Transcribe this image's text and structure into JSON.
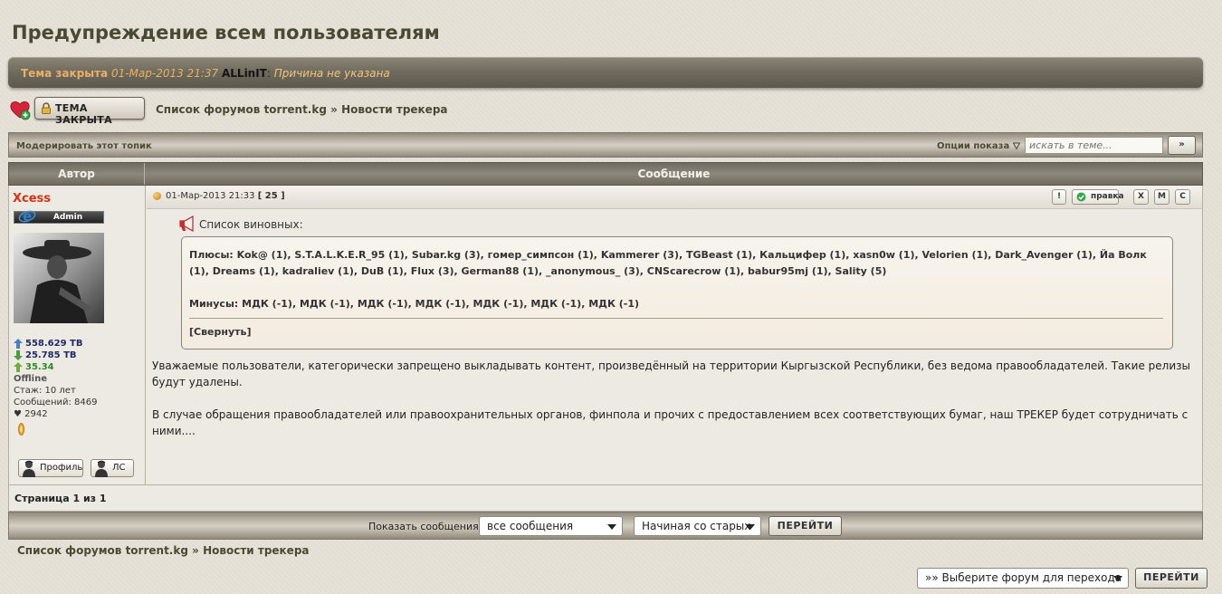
{
  "topic": {
    "title": "Предупреждение всем пользователям"
  },
  "closed_notice": {
    "label": "Тема закрыта",
    "date": "01-Мар-2013 21:37",
    "user": "ALLinIT",
    "reason": "Причина не указана"
  },
  "nav": {
    "closed_button": "Тема закрыта",
    "crumb_forums": "Список форумов torrent.kg",
    "crumb_sep": "»",
    "crumb_section": "Новости трекера"
  },
  "toolbar": {
    "moderate": "Модерировать этот топик",
    "view_options": "Опции показа",
    "search_placeholder": "искать в теме...",
    "search_button": "»"
  },
  "table": {
    "col_author": "Автор",
    "col_message": "Сообщение"
  },
  "author": {
    "name": "Xcess",
    "rank": "Admin",
    "uploaded": "558.629 TB",
    "downloaded": "25.785 TB",
    "ratio": "35.34",
    "status": "Offline",
    "tenure": "Стаж: 10 лет",
    "posts": "Сообщений: 8469",
    "rep": "♥ 2942",
    "profile_btn": "Профиль",
    "pm_btn": "ЛС",
    "colors": {
      "name": "#d9300f",
      "ratio": "#2e8a2e"
    }
  },
  "post": {
    "date": "01-Мар-2013 21:33",
    "number": "[ 25 ]",
    "buttons": [
      "!",
      "правка",
      "X",
      "M",
      "C"
    ],
    "quote_label": "Список виновных:",
    "spoiler": {
      "plus": "Плюсы: Kok@ (1), S.T.A.L.K.E.R_95 (1), Subar.kg (3), гомер_симпсон (1), Kammerer (3), TGBeast (1), Кальцифер (1), xasn0w (1), Velorien (1), Dark_Avenger (1), Йа Волк (1), Dreams (1), kadraliev (1), DuB (1), Flux (3), German88 (1), _anonymous_ (3), CNScarecrow (1), babur95mj (1), Sality (5)",
      "minus": "Минусы: МДК (-1), МДК (-1), МДК (-1), МДК (-1), МДК (-1), МДК (-1), МДК (-1)",
      "collapse": "[Свернуть]"
    },
    "paragraph1": "Уважаемые пользователи, категорически запрещено выкладывать контент, произведённый на территории Кыргызской Республики, без ведома правообладателей. Такие релизы будут удалены.",
    "paragraph2": "В случае обращения правообладателей или правоохранительных органов, финпола и прочих с предоставлением всех соответствующих бумаг, наш ТРЕКЕР будет сотрудничать с ними...."
  },
  "pagination": {
    "text": "Страница 1 из 1"
  },
  "bottom": {
    "show_label": "Показать сообщения:",
    "show_select": "все сообщения",
    "order_select": "Начиная со старых",
    "go_button": "ПЕРЕЙТИ",
    "jump_select": "»» Выберите форум для перехода",
    "jump_button": "ПЕРЕЙТИ"
  }
}
